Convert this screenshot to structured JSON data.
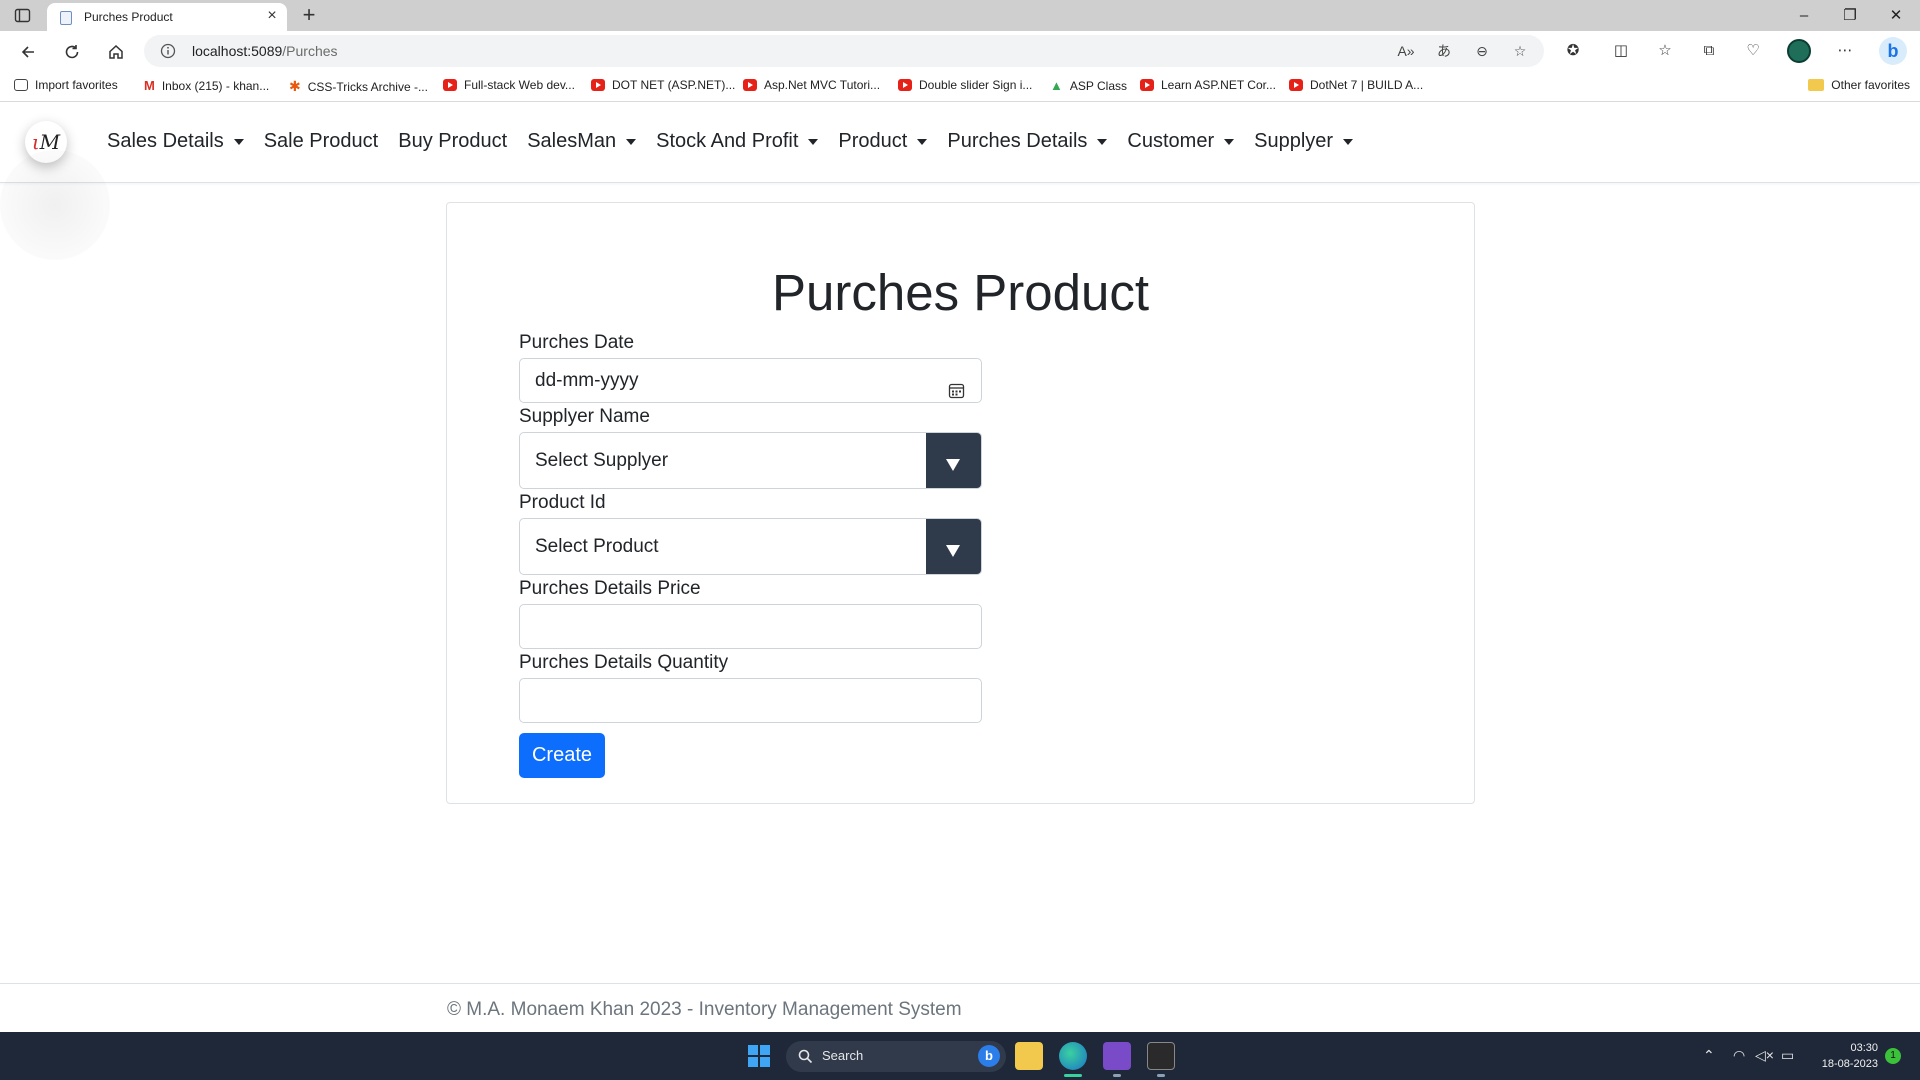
{
  "browser": {
    "tab_title": "Purches Product",
    "url_host": "localhost:5089",
    "url_path": "/Purches",
    "favorites": [
      {
        "label": "Import favorites"
      },
      {
        "label": "Inbox (215) - khan..."
      },
      {
        "label": "CSS-Tricks Archive -..."
      },
      {
        "label": "Full-stack Web dev..."
      },
      {
        "label": "DOT NET (ASP.NET)..."
      },
      {
        "label": "Asp.Net MVC Tutori..."
      },
      {
        "label": "Double slider Sign i..."
      },
      {
        "label": "ASP Class"
      },
      {
        "label": "Learn ASP.NET Cor..."
      },
      {
        "label": "DotNet 7 | BUILD A..."
      }
    ],
    "other_favorites": "Other favorites"
  },
  "nav": {
    "logo_text": "M",
    "items": [
      {
        "label": "Sales Details",
        "dropdown": true
      },
      {
        "label": "Sale Product",
        "dropdown": false
      },
      {
        "label": "Buy Product",
        "dropdown": false
      },
      {
        "label": "SalesMan",
        "dropdown": true
      },
      {
        "label": "Stock And Profit",
        "dropdown": true
      },
      {
        "label": "Product",
        "dropdown": true
      },
      {
        "label": "Purches Details",
        "dropdown": true
      },
      {
        "label": "Customer",
        "dropdown": true
      },
      {
        "label": "Supplyer",
        "dropdown": true
      }
    ]
  },
  "form": {
    "title": "Purches Product",
    "date_label": "Purches Date",
    "date_placeholder": "dd-mm-yyyy",
    "supplier_label": "Supplyer Name",
    "supplier_value": "Select Supplyer",
    "product_label": "Product Id",
    "product_value": "Select Product",
    "price_label": "Purches Details Price",
    "price_value": "",
    "quantity_label": "Purches Details Quantity",
    "quantity_value": "",
    "submit_label": "Create"
  },
  "footer": {
    "text": "© M.A. Monaem Khan 2023 - Inventory Management System"
  },
  "taskbar": {
    "search_label": "Search",
    "time": "03:30",
    "date": "18-08-2023",
    "notification_count": "1"
  },
  "colors": {
    "primary_button": "#0d6efd",
    "select_arrow": "#2f3a4b",
    "taskbar": "#1f2838"
  }
}
